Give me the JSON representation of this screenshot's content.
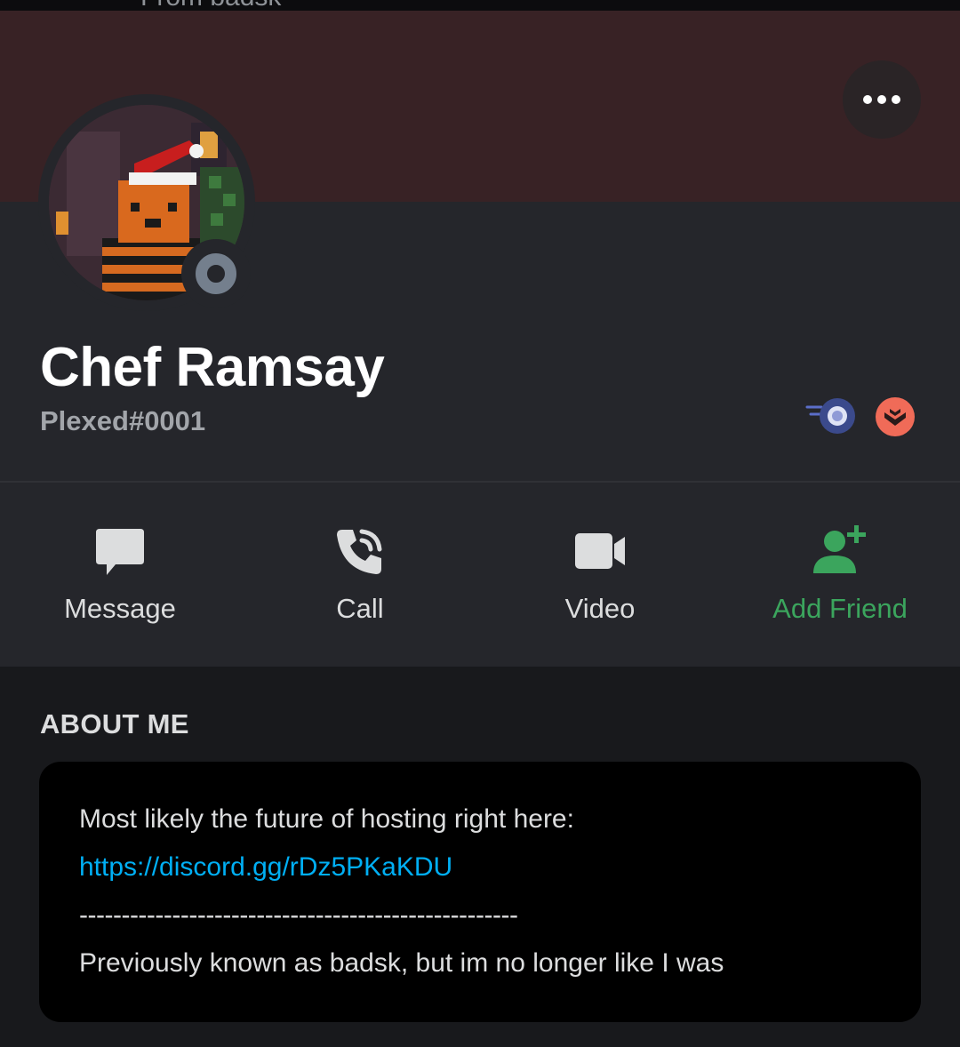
{
  "top_strip": {
    "text": "From badsk"
  },
  "profile": {
    "display_name": "Chef Ramsay",
    "tag": "Plexed#0001",
    "status": "offline",
    "badges": [
      "hypesquad-balance-badge",
      "bug-hunter-badge"
    ],
    "banner_color": "#382225"
  },
  "actions": [
    {
      "label": "Message",
      "icon": "message-icon"
    },
    {
      "label": "Call",
      "icon": "phone-icon"
    },
    {
      "label": "Video",
      "icon": "video-camera-icon"
    },
    {
      "label": "Add Friend",
      "icon": "add-friend-icon",
      "color": "#3ba55d"
    }
  ],
  "about": {
    "title": "ABOUT ME",
    "line1": "Most likely the future of hosting right here:",
    "link": "https://discord.gg/rDz5PKaKDU",
    "separator": "----------------------------------------------------",
    "line2": "Previously known as badsk, but im no longer like I was"
  },
  "colors": {
    "background": "#18191c",
    "panel": "#25262b",
    "link": "#00aff4",
    "add_friend": "#3ba55d",
    "offline": "#747f8d"
  }
}
